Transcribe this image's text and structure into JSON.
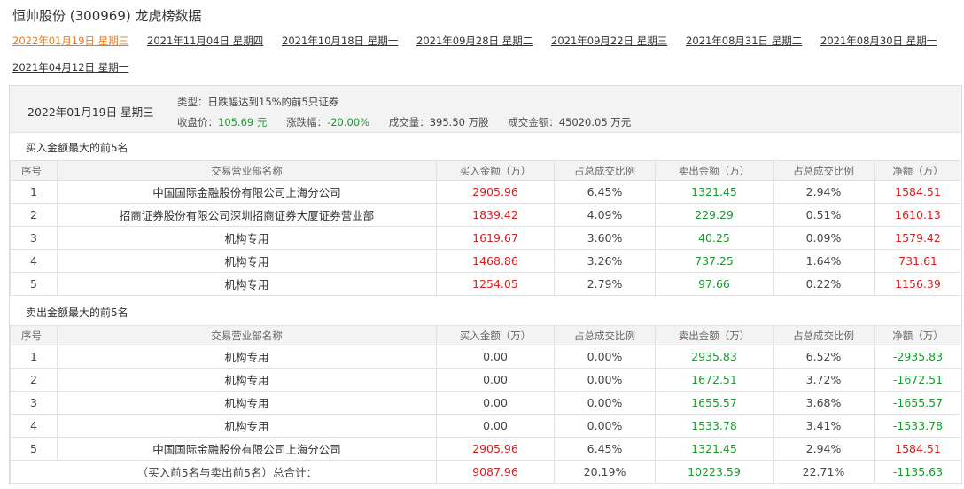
{
  "page": {
    "title": "恒帅股份 (300969)  龙虎榜数据"
  },
  "date_tabs": [
    {
      "label": "2022年01月19日 星期三",
      "active": true
    },
    {
      "label": "2021年11月04日 星期四",
      "active": false
    },
    {
      "label": "2021年10月18日 星期一",
      "active": false
    },
    {
      "label": "2021年09月28日 星期二",
      "active": false
    },
    {
      "label": "2021年09月22日 星期三",
      "active": false
    },
    {
      "label": "2021年08月31日 星期二",
      "active": false
    },
    {
      "label": "2021年08月30日 星期一",
      "active": false
    },
    {
      "label": "2021年04月12日 星期一",
      "active": false
    }
  ],
  "summary": {
    "date": "2022年01月19日 星期三",
    "type_label": "类型：",
    "type_value": "日跌幅达到15%的前5只证券",
    "close_label": "收盘价：",
    "close_value": "105.69 元",
    "change_label": "涨跌幅：",
    "change_value": "-20.00%",
    "volume_label": "成交量：",
    "volume_value": "395.50 万股",
    "amount_label": "成交金额：",
    "amount_value": "45020.05 万元"
  },
  "columns": [
    "序号",
    "交易营业部名称",
    "买入金额（万）",
    "占总成交比例",
    "卖出金额（万）",
    "占总成交比例",
    "净额（万）"
  ],
  "buy_section": {
    "title": "买入金额最大的前5名",
    "rows": [
      {
        "idx": "1",
        "name": "中国国际金融股份有限公司上海分公司",
        "buy": "2905.96",
        "buy_pct": "6.45%",
        "sell": "1321.45",
        "sell_pct": "2.94%",
        "net": "1584.51"
      },
      {
        "idx": "2",
        "name": "招商证券股份有限公司深圳招商证券大厦证券营业部",
        "buy": "1839.42",
        "buy_pct": "4.09%",
        "sell": "229.29",
        "sell_pct": "0.51%",
        "net": "1610.13"
      },
      {
        "idx": "3",
        "name": "机构专用",
        "buy": "1619.67",
        "buy_pct": "3.60%",
        "sell": "40.25",
        "sell_pct": "0.09%",
        "net": "1579.42"
      },
      {
        "idx": "4",
        "name": "机构专用",
        "buy": "1468.86",
        "buy_pct": "3.26%",
        "sell": "737.25",
        "sell_pct": "1.64%",
        "net": "731.61"
      },
      {
        "idx": "5",
        "name": "机构专用",
        "buy": "1254.05",
        "buy_pct": "2.79%",
        "sell": "97.66",
        "sell_pct": "0.22%",
        "net": "1156.39"
      }
    ]
  },
  "sell_section": {
    "title": "卖出金额最大的前5名",
    "rows": [
      {
        "idx": "1",
        "name": "机构专用",
        "buy": "0.00",
        "buy_pct": "0.00%",
        "sell": "2935.83",
        "sell_pct": "6.52%",
        "net": "-2935.83"
      },
      {
        "idx": "2",
        "name": "机构专用",
        "buy": "0.00",
        "buy_pct": "0.00%",
        "sell": "1672.51",
        "sell_pct": "3.72%",
        "net": "-1672.51"
      },
      {
        "idx": "3",
        "name": "机构专用",
        "buy": "0.00",
        "buy_pct": "0.00%",
        "sell": "1655.57",
        "sell_pct": "3.68%",
        "net": "-1655.57"
      },
      {
        "idx": "4",
        "name": "机构专用",
        "buy": "0.00",
        "buy_pct": "0.00%",
        "sell": "1533.78",
        "sell_pct": "3.41%",
        "net": "-1533.78"
      },
      {
        "idx": "5",
        "name": "中国国际金融股份有限公司上海分公司",
        "buy": "2905.96",
        "buy_pct": "6.45%",
        "sell": "1321.45",
        "sell_pct": "2.94%",
        "net": "1584.51"
      }
    ],
    "total": {
      "label": "（买入前5名与卖出前5名）总合计：",
      "buy": "9087.96",
      "buy_pct": "20.19%",
      "sell": "10223.59",
      "sell_pct": "22.71%",
      "net": "-1135.63"
    }
  },
  "colors": {
    "active_tab": "#e67e22",
    "up": "#d32222",
    "down": "#1a9a2e",
    "header_bg": "#f3f3f3",
    "border": "#e2e2e2"
  }
}
